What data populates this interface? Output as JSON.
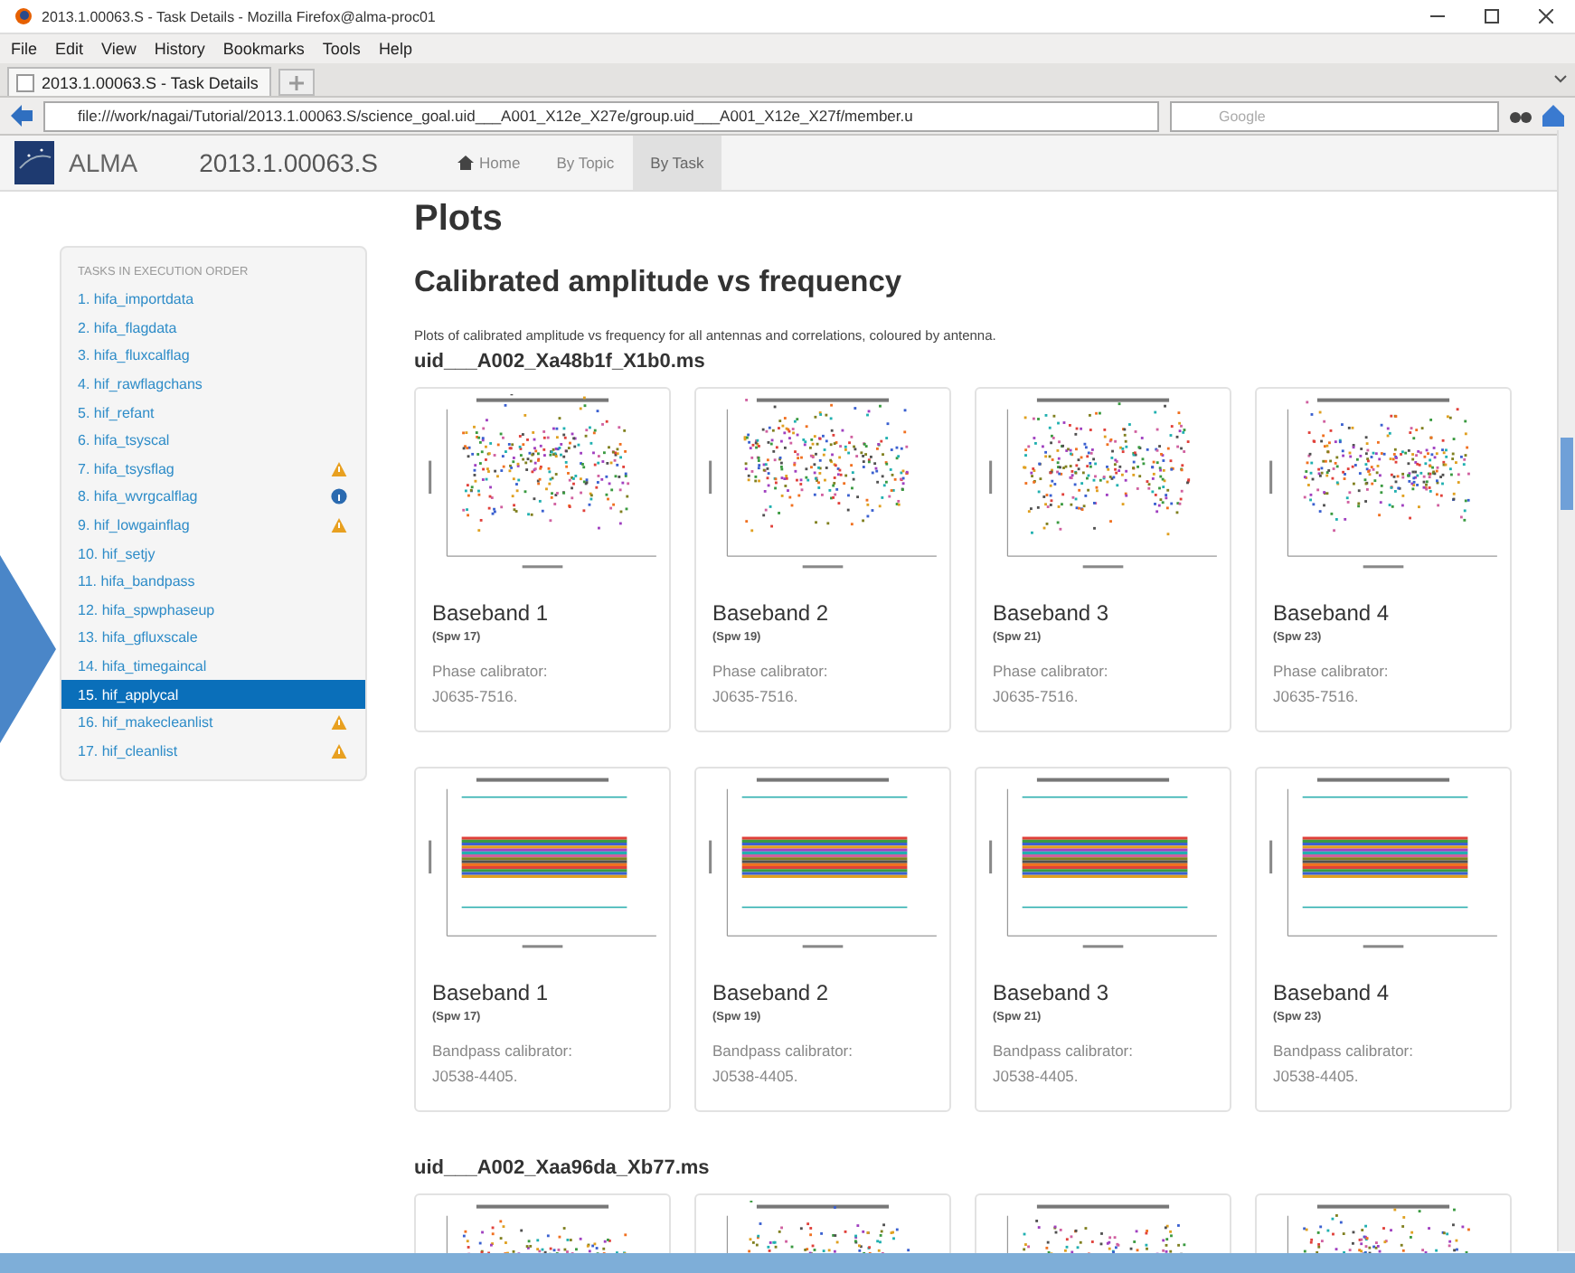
{
  "window": {
    "title": "2013.1.00063.S - Task Details - Mozilla Firefox@alma-proc01"
  },
  "menu": [
    "File",
    "Edit",
    "View",
    "History",
    "Bookmarks",
    "Tools",
    "Help"
  ],
  "tabs": [
    {
      "label": "2013.1.00063.S - Task Details",
      "selected": true
    }
  ],
  "url": {
    "value": "file:///work/nagai/Tutorial/2013.1.00063.S/science_goal.uid___A001_X12e_X27e/group.uid___A001_X12e_X27f/member.u"
  },
  "search": {
    "placeholder": "Google"
  },
  "navbar": {
    "brand": "ALMA",
    "project": "2013.1.00063.S",
    "items": [
      {
        "label": "Home",
        "kind": "home",
        "selected": false
      },
      {
        "label": "By Topic",
        "kind": "plain",
        "selected": false
      },
      {
        "label": "By Task",
        "kind": "plain",
        "selected": true
      }
    ]
  },
  "sidebar": {
    "heading": "TASKS IN EXECUTION ORDER",
    "items": [
      {
        "label": "1. hifa_importdata",
        "selected": false
      },
      {
        "label": "2. hifa_flagdata",
        "selected": false
      },
      {
        "label": "3. hifa_fluxcalflag",
        "selected": false
      },
      {
        "label": "4. hif_rawflagchans",
        "selected": false
      },
      {
        "label": "5. hif_refant",
        "selected": false
      },
      {
        "label": "6. hifa_tsyscal",
        "selected": false
      },
      {
        "label": "7. hifa_tsysflag",
        "selected": false,
        "kind": "warning"
      },
      {
        "label": "8. hifa_wvrgcalflag",
        "selected": false,
        "kind": "info"
      },
      {
        "label": "9. hif_lowgainflag",
        "selected": false,
        "kind": "warning"
      },
      {
        "label": "10. hif_setjy",
        "selected": false
      },
      {
        "label": "11. hifa_bandpass",
        "selected": false
      },
      {
        "label": "12. hifa_spwphaseup",
        "selected": false
      },
      {
        "label": "13. hifa_gfluxscale",
        "selected": false
      },
      {
        "label": "14. hifa_timegaincal",
        "selected": false
      },
      {
        "label": "15. hif_applycal",
        "selected": true
      },
      {
        "label": "16. hif_makecleanlist",
        "selected": false,
        "kind": "warning"
      },
      {
        "label": "17. hif_cleanlist",
        "selected": false,
        "kind": "warning"
      }
    ]
  },
  "content": {
    "title": "Plots",
    "section": "Calibrated amplitude vs frequency",
    "description": "Plots of calibrated amplitude vs frequency for all antennas and correlations, coloured by antenna.",
    "groups": [
      {
        "ms": "uid___A002_Xa48b1f_X1b0.ms",
        "cards": [
          {
            "kind": "scatter",
            "title": "Baseband 1",
            "spw": "(Spw 17)",
            "caption": "Phase calibrator:",
            "source": "J0635-7516."
          },
          {
            "kind": "scatter",
            "title": "Baseband 2",
            "spw": "(Spw 19)",
            "caption": "Phase calibrator:",
            "source": "J0635-7516."
          },
          {
            "kind": "scatter",
            "title": "Baseband 3",
            "spw": "(Spw 21)",
            "caption": "Phase calibrator:",
            "source": "J0635-7516."
          },
          {
            "kind": "scatter",
            "title": "Baseband 4",
            "spw": "(Spw 23)",
            "caption": "Phase calibrator:",
            "source": "J0635-7516."
          },
          {
            "kind": "band",
            "title": "Baseband 1",
            "spw": "(Spw 17)",
            "caption": "Bandpass calibrator:",
            "source": "J0538-4405."
          },
          {
            "kind": "band",
            "title": "Baseband 2",
            "spw": "(Spw 19)",
            "caption": "Bandpass calibrator:",
            "source": "J0538-4405."
          },
          {
            "kind": "band",
            "title": "Baseband 3",
            "spw": "(Spw 21)",
            "caption": "Bandpass calibrator:",
            "source": "J0538-4405."
          },
          {
            "kind": "band",
            "title": "Baseband 4",
            "spw": "(Spw 23)",
            "caption": "Bandpass calibrator:",
            "source": "J0538-4405."
          }
        ]
      },
      {
        "ms": "uid___A002_Xaa96da_Xb77.ms",
        "cards": [
          {
            "kind": "scatter"
          },
          {
            "kind": "scatter"
          },
          {
            "kind": "scatter"
          },
          {
            "kind": "scatter"
          }
        ]
      }
    ]
  }
}
